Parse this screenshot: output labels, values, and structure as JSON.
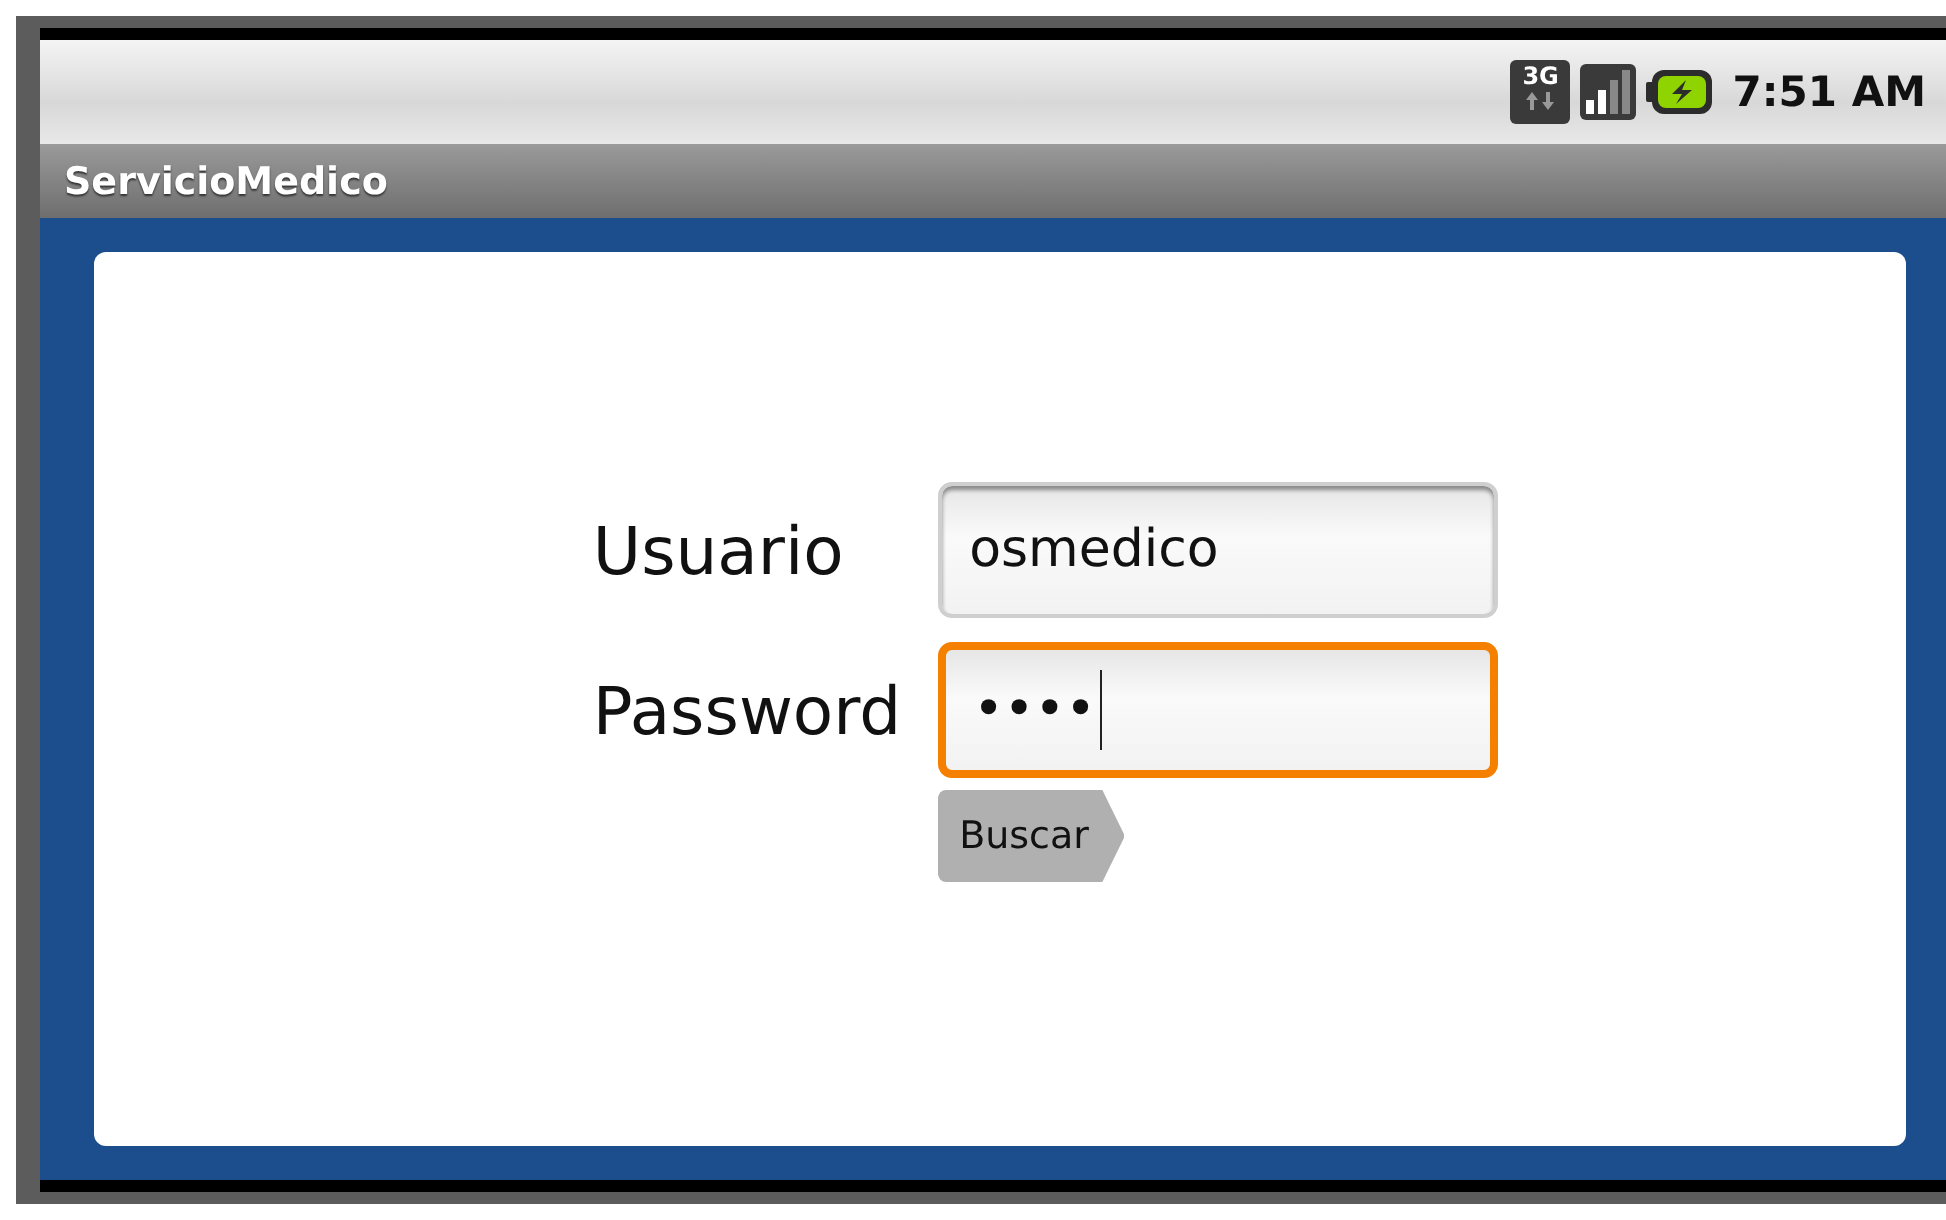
{
  "status_bar": {
    "network_type": "3G",
    "time": "7:51 AM"
  },
  "window": {
    "title": "ServicioMedico"
  },
  "fields": [
    {
      "label": "Usuario",
      "value": "osmedico",
      "focused": false
    },
    {
      "label": "Password",
      "value": "••••",
      "focused": true
    }
  ],
  "buttons": [
    "Buscar"
  ]
}
